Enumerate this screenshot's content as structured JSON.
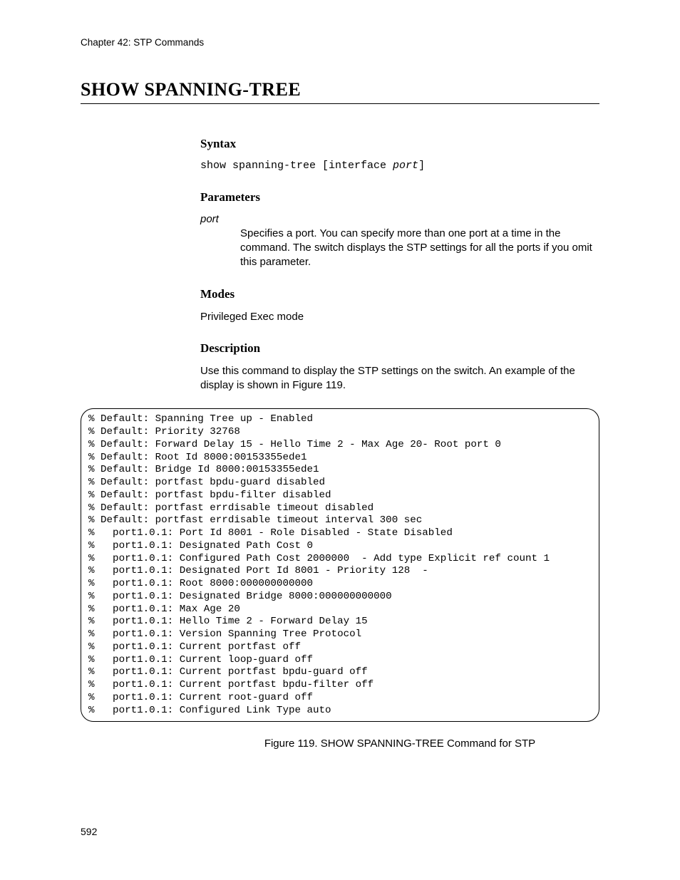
{
  "chapter_header": "Chapter 42: STP Commands",
  "title": "SHOW SPANNING-TREE",
  "sections": {
    "syntax": {
      "heading": "Syntax",
      "code_prefix": "show spanning-tree [interface ",
      "code_ital": "port",
      "code_suffix": "]"
    },
    "parameters": {
      "heading": "Parameters",
      "term": "port",
      "desc": "Specifies a port. You can specify more than one port at a time in the command. The switch displays the STP settings for all the ports if you omit this parameter."
    },
    "modes": {
      "heading": "Modes",
      "text": "Privileged Exec mode"
    },
    "description": {
      "heading": "Description",
      "text": "Use this command to display the STP settings on the switch. An example of the display is shown in Figure 119."
    }
  },
  "code_block": "% Default: Spanning Tree up - Enabled\n% Default: Priority 32768\n% Default: Forward Delay 15 - Hello Time 2 - Max Age 20- Root port 0\n% Default: Root Id 8000:00153355ede1\n% Default: Bridge Id 8000:00153355ede1\n% Default: portfast bpdu-guard disabled\n% Default: portfast bpdu-filter disabled\n% Default: portfast errdisable timeout disabled\n% Default: portfast errdisable timeout interval 300 sec\n%   port1.0.1: Port Id 8001 - Role Disabled - State Disabled\n%   port1.0.1: Designated Path Cost 0\n%   port1.0.1: Configured Path Cost 2000000  - Add type Explicit ref count 1\n%   port1.0.1: Designated Port Id 8001 - Priority 128  -\n%   port1.0.1: Root 8000:000000000000\n%   port1.0.1: Designated Bridge 8000:000000000000\n%   port1.0.1: Max Age 20\n%   port1.0.1: Hello Time 2 - Forward Delay 15\n%   port1.0.1: Version Spanning Tree Protocol\n%   port1.0.1: Current portfast off\n%   port1.0.1: Current loop-guard off\n%   port1.0.1: Current portfast bpdu-guard off\n%   port1.0.1: Current portfast bpdu-filter off\n%   port1.0.1: Current root-guard off\n%   port1.0.1: Configured Link Type auto",
  "figure_caption": "Figure 119. SHOW SPANNING-TREE Command for STP",
  "page_number": "592"
}
